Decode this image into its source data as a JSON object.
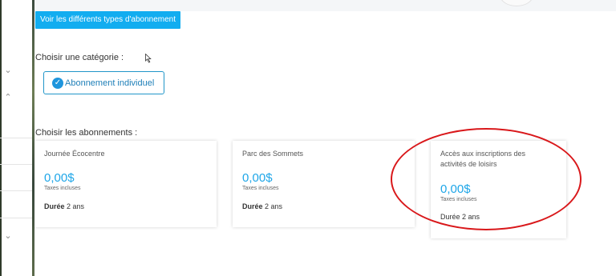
{
  "header": {
    "types_button_label": "Voir les différents types d'abonnement"
  },
  "categories": {
    "label": "Choisir une catégorie :",
    "selected": "Abonnement individuel"
  },
  "subscriptions": {
    "label": "Choisir les abonnements :",
    "cards": [
      {
        "title": "Journée Écocentre",
        "price": "0,00$",
        "taxes": "Taxes incluses",
        "duration_label": "Durée",
        "duration_value": "2 ans"
      },
      {
        "title": "Parc des Sommets",
        "price": "0,00$",
        "taxes": "Taxes incluses",
        "duration_label": "Durée",
        "duration_value": "2 ans"
      },
      {
        "title": "Accès aux inscriptions des activités de loisirs",
        "price": "0,00$",
        "taxes": "Taxes incluses",
        "duration_label": "Durée",
        "duration_value": "2 ans"
      }
    ]
  },
  "colors": {
    "accent": "#12adf0",
    "price": "#1ea6e8",
    "annotation": "#d9181b"
  },
  "icons": {
    "check": "check-circle-icon",
    "chevron_down": "chevron-down-icon",
    "chevron_up": "chevron-up-icon"
  }
}
